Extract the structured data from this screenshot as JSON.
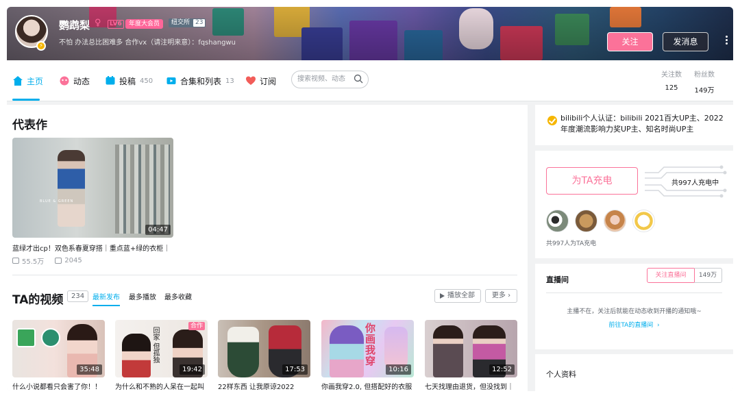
{
  "profile": {
    "name": "鹦鹉梨",
    "gender_symbol": "♀",
    "level": "LV6",
    "vip": "年度大会员",
    "medal_name": "纽交所",
    "medal_level": "23",
    "sign": "不怕 办法总比困难多 合作vx（请注明来意）：fqshangwu",
    "follow_label": "关注",
    "message_label": "发消息"
  },
  "nav": {
    "items": [
      {
        "label": "主页",
        "count": ""
      },
      {
        "label": "动态",
        "count": ""
      },
      {
        "label": "投稿",
        "count": "450"
      },
      {
        "label": "合集和列表",
        "count": "13"
      },
      {
        "label": "订阅",
        "count": ""
      }
    ],
    "search_placeholder": "搜索视频、动态",
    "following_label": "关注数",
    "following_value": "125",
    "fans_label": "粉丝数",
    "fans_value": "149万"
  },
  "representative": {
    "heading": "代表作",
    "thumb_text": "BLUE & GREEN",
    "duration": "04:47",
    "title": "蓝绿才出cp！双色系春夏穿搭｜重点蓝+绿的衣柜｜",
    "views": "55.5万",
    "danmaku": "2045"
  },
  "videos": {
    "heading": "TA的视频",
    "count": "234",
    "tabs": [
      "最新发布",
      "最多播放",
      "最多收藏"
    ],
    "play_all": "播放全部",
    "more": "更多",
    "items": [
      {
        "duration": "35:48",
        "title": "什么小说都看只会害了你！！"
      },
      {
        "duration": "19:42",
        "title": "为什么和不熟的人呆在一起叫",
        "badge": "合作",
        "thumb_text": "回家 但孤独"
      },
      {
        "duration": "17:53",
        "title": "22样东西 让我原谅2022"
      },
      {
        "duration": "10:16",
        "title": "你画我穿2.0, 但搭配好的衣服",
        "thumb_text": "你画我穿"
      },
      {
        "duration": "12:52",
        "title": "七天找理由退货，但没找到｜"
      }
    ]
  },
  "certification": {
    "text": "bilibili个人认证：bilibili 2021百大UP主、2022年度潮流影响力奖UP主、知名时尚UP主"
  },
  "charge": {
    "button": "为TA充电",
    "count_text": "共997人充电中",
    "note": "共997人为TA充电"
  },
  "live": {
    "title": "直播间",
    "follow_label": "关注直播间",
    "fans": "149万",
    "message": "主播不在，关注后就能在动态收到开播的通知哦~",
    "link": "前往TA的直播间"
  },
  "personal_info": {
    "title": "个人资料"
  },
  "colors": {
    "accent_blue": "#00aeec",
    "accent_pink": "#fb7299",
    "vip_pink": "#ff6699"
  }
}
